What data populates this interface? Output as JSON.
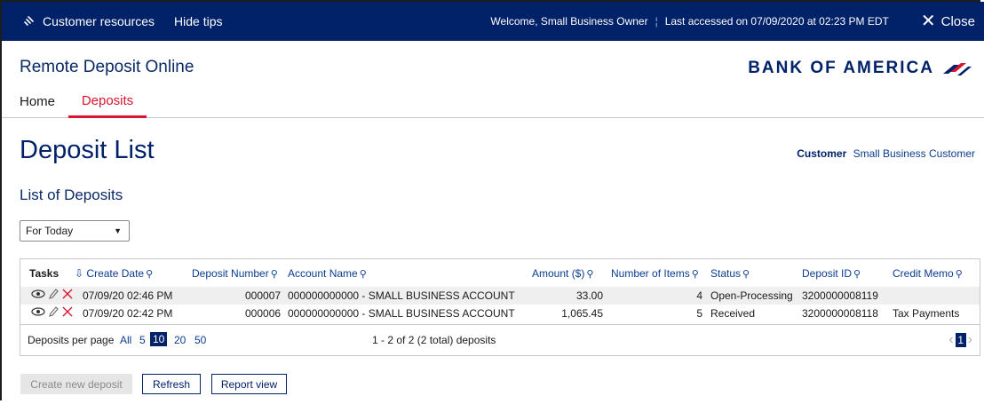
{
  "topbar": {
    "resources": "Customer resources",
    "hide_tips": "Hide tips",
    "welcome": "Welcome, Small Business Owner",
    "last_access": "Last accessed on 07/09/2020 at 02:23 PM EDT",
    "close": "Close",
    "bg_color": "#012169"
  },
  "header": {
    "app_title": "Remote Deposit Online",
    "logo_text": "BANK OF AMERICA"
  },
  "nav": {
    "home": "Home",
    "deposits": "Deposits",
    "active_color": "#dc1431"
  },
  "page": {
    "title": "Deposit List",
    "customer_label": "Customer",
    "customer_value": "Small Business Customer",
    "section_title": "List of Deposits",
    "filter_value": "For Today"
  },
  "table": {
    "headers": {
      "tasks": "Tasks",
      "create_date": "Create Date",
      "deposit_number": "Deposit Number",
      "account_name": "Account Name",
      "amount": "Amount ($)",
      "items": "Number of Items",
      "status": "Status",
      "deposit_id": "Deposit ID",
      "credit_memo": "Credit Memo"
    },
    "rows": [
      {
        "create_date": "07/09/20 02:46 PM",
        "deposit_number": "000007",
        "account_name": "000000000000 - SMALL BUSINESS ACCOUNT",
        "amount": "33.00",
        "items": "4",
        "status": "Open-Processing",
        "deposit_id": "3200000008119",
        "credit_memo": ""
      },
      {
        "create_date": "07/09/20 02:42 PM",
        "deposit_number": "000006",
        "account_name": "000000000000 - SMALL BUSINESS ACCOUNT",
        "amount": "1,065.45",
        "items": "5",
        "status": "Received",
        "deposit_id": "3200000008118",
        "credit_memo": "Tax Payments"
      }
    ],
    "footer": {
      "per_page_label": "Deposits per page",
      "options": [
        "All",
        "5",
        "10",
        "20",
        "50"
      ],
      "selected": "10",
      "summary": "1 - 2 of 2 (2 total) deposits",
      "current_page": "1"
    }
  },
  "buttons": {
    "create": "Create new deposit",
    "refresh": "Refresh",
    "report": "Report view"
  }
}
